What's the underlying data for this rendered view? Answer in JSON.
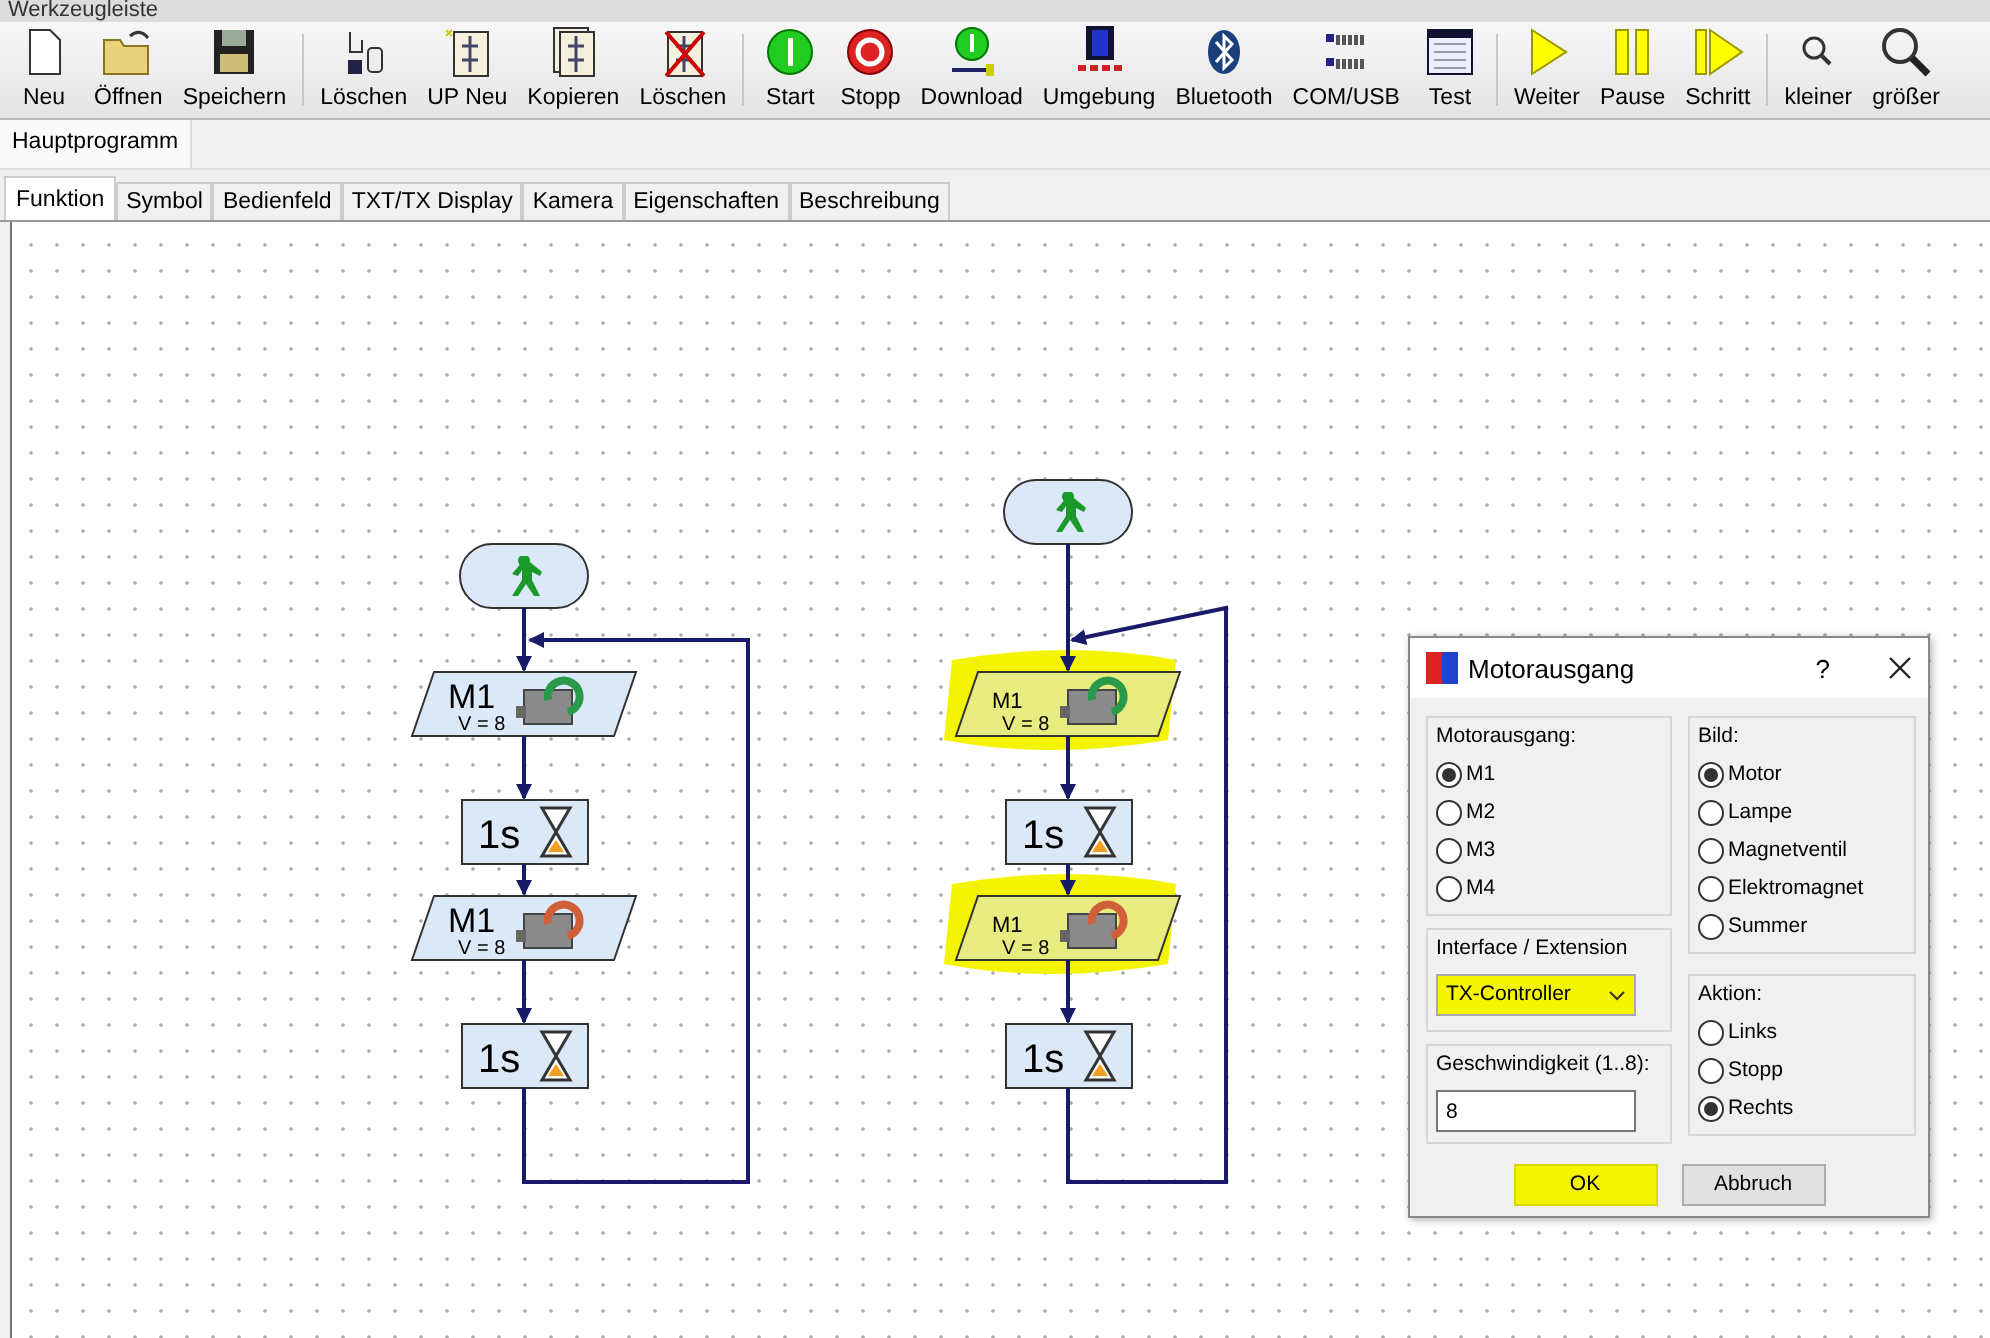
{
  "window": {
    "title": "Werkzeugleiste"
  },
  "toolbar": [
    [
      {
        "kind": "new",
        "label": "Neu"
      },
      {
        "kind": "open",
        "label": "Öffnen"
      },
      {
        "kind": "save",
        "label": "Speichern"
      }
    ],
    [
      {
        "kind": "delete-element",
        "label": "Löschen"
      },
      {
        "kind": "sub-new",
        "label": "UP Neu"
      },
      {
        "kind": "copy",
        "label": "Kopieren"
      },
      {
        "kind": "delete-sub",
        "label": "Löschen"
      }
    ],
    [
      {
        "kind": "start",
        "label": "Start"
      },
      {
        "kind": "stop",
        "label": "Stopp"
      },
      {
        "kind": "download",
        "label": "Download"
      },
      {
        "kind": "environment",
        "label": "Umgebung"
      },
      {
        "kind": "bluetooth",
        "label": "Bluetooth"
      },
      {
        "kind": "comusb",
        "label": "COM/USB"
      },
      {
        "kind": "test",
        "label": "Test"
      }
    ],
    [
      {
        "kind": "continue",
        "label": "Weiter"
      },
      {
        "kind": "pause",
        "label": "Pause"
      },
      {
        "kind": "step",
        "label": "Schritt"
      }
    ],
    [
      {
        "kind": "zoom-out",
        "label": "kleiner"
      },
      {
        "kind": "zoom-in",
        "label": "größer"
      }
    ]
  ],
  "program_tabs": [
    {
      "label": "Hauptprogramm",
      "selected": true
    }
  ],
  "view_tabs": [
    {
      "label": "Funktion",
      "selected": true
    },
    {
      "label": "Symbol",
      "selected": false
    },
    {
      "label": "Bedienfeld",
      "selected": false
    },
    {
      "label": "TXT/TX Display",
      "selected": false
    },
    {
      "label": "Kamera",
      "selected": false
    },
    {
      "label": "Eigenschaften",
      "selected": false
    },
    {
      "label": "Beschreibung",
      "selected": false
    }
  ],
  "flowcharts": [
    {
      "nodes": [
        {
          "kind": "start"
        },
        {
          "kind": "motor",
          "output": "M1",
          "speed": "V = 8",
          "clockwise": false,
          "highlighted": false
        },
        {
          "kind": "wait",
          "text": "1s"
        },
        {
          "kind": "motor",
          "output": "M1",
          "speed": "V = 8",
          "clockwise": true,
          "highlighted": false
        },
        {
          "kind": "wait",
          "text": "1s"
        }
      ]
    },
    {
      "nodes": [
        {
          "kind": "start"
        },
        {
          "kind": "motor",
          "output": "M1",
          "speed": "V = 8",
          "clockwise": false,
          "highlighted": true
        },
        {
          "kind": "wait",
          "text": "1s"
        },
        {
          "kind": "motor",
          "output": "M1",
          "speed": "V = 8",
          "clockwise": true,
          "highlighted": true
        },
        {
          "kind": "wait",
          "text": "1s"
        }
      ]
    }
  ],
  "dialog": {
    "title": "Motorausgang",
    "help": "?",
    "motor_output": {
      "label": "Motorausgang:",
      "options": [
        {
          "label": "M1",
          "selected": true
        },
        {
          "label": "M2",
          "selected": false
        },
        {
          "label": "M3",
          "selected": false
        },
        {
          "label": "M4",
          "selected": false
        }
      ]
    },
    "interface": {
      "label": "Interface / Extension",
      "value": "TX-Controller",
      "highlighted": true
    },
    "speed": {
      "label": "Geschwindigkeit (1..8):",
      "value": "8"
    },
    "image": {
      "label": "Bild:",
      "options": [
        {
          "label": "Motor",
          "selected": true
        },
        {
          "label": "Lampe",
          "selected": false
        },
        {
          "label": "Magnetventil",
          "selected": false
        },
        {
          "label": "Elektromagnet",
          "selected": false
        },
        {
          "label": "Summer",
          "selected": false
        }
      ]
    },
    "action": {
      "label": "Aktion:",
      "options": [
        {
          "label": "Links",
          "selected": false
        },
        {
          "label": "Stopp",
          "selected": false
        },
        {
          "label": "Rechts",
          "selected": true
        }
      ]
    },
    "buttons": [
      {
        "label": "OK",
        "highlighted": true
      },
      {
        "label": "Abbruch",
        "highlighted": false
      }
    ]
  }
}
